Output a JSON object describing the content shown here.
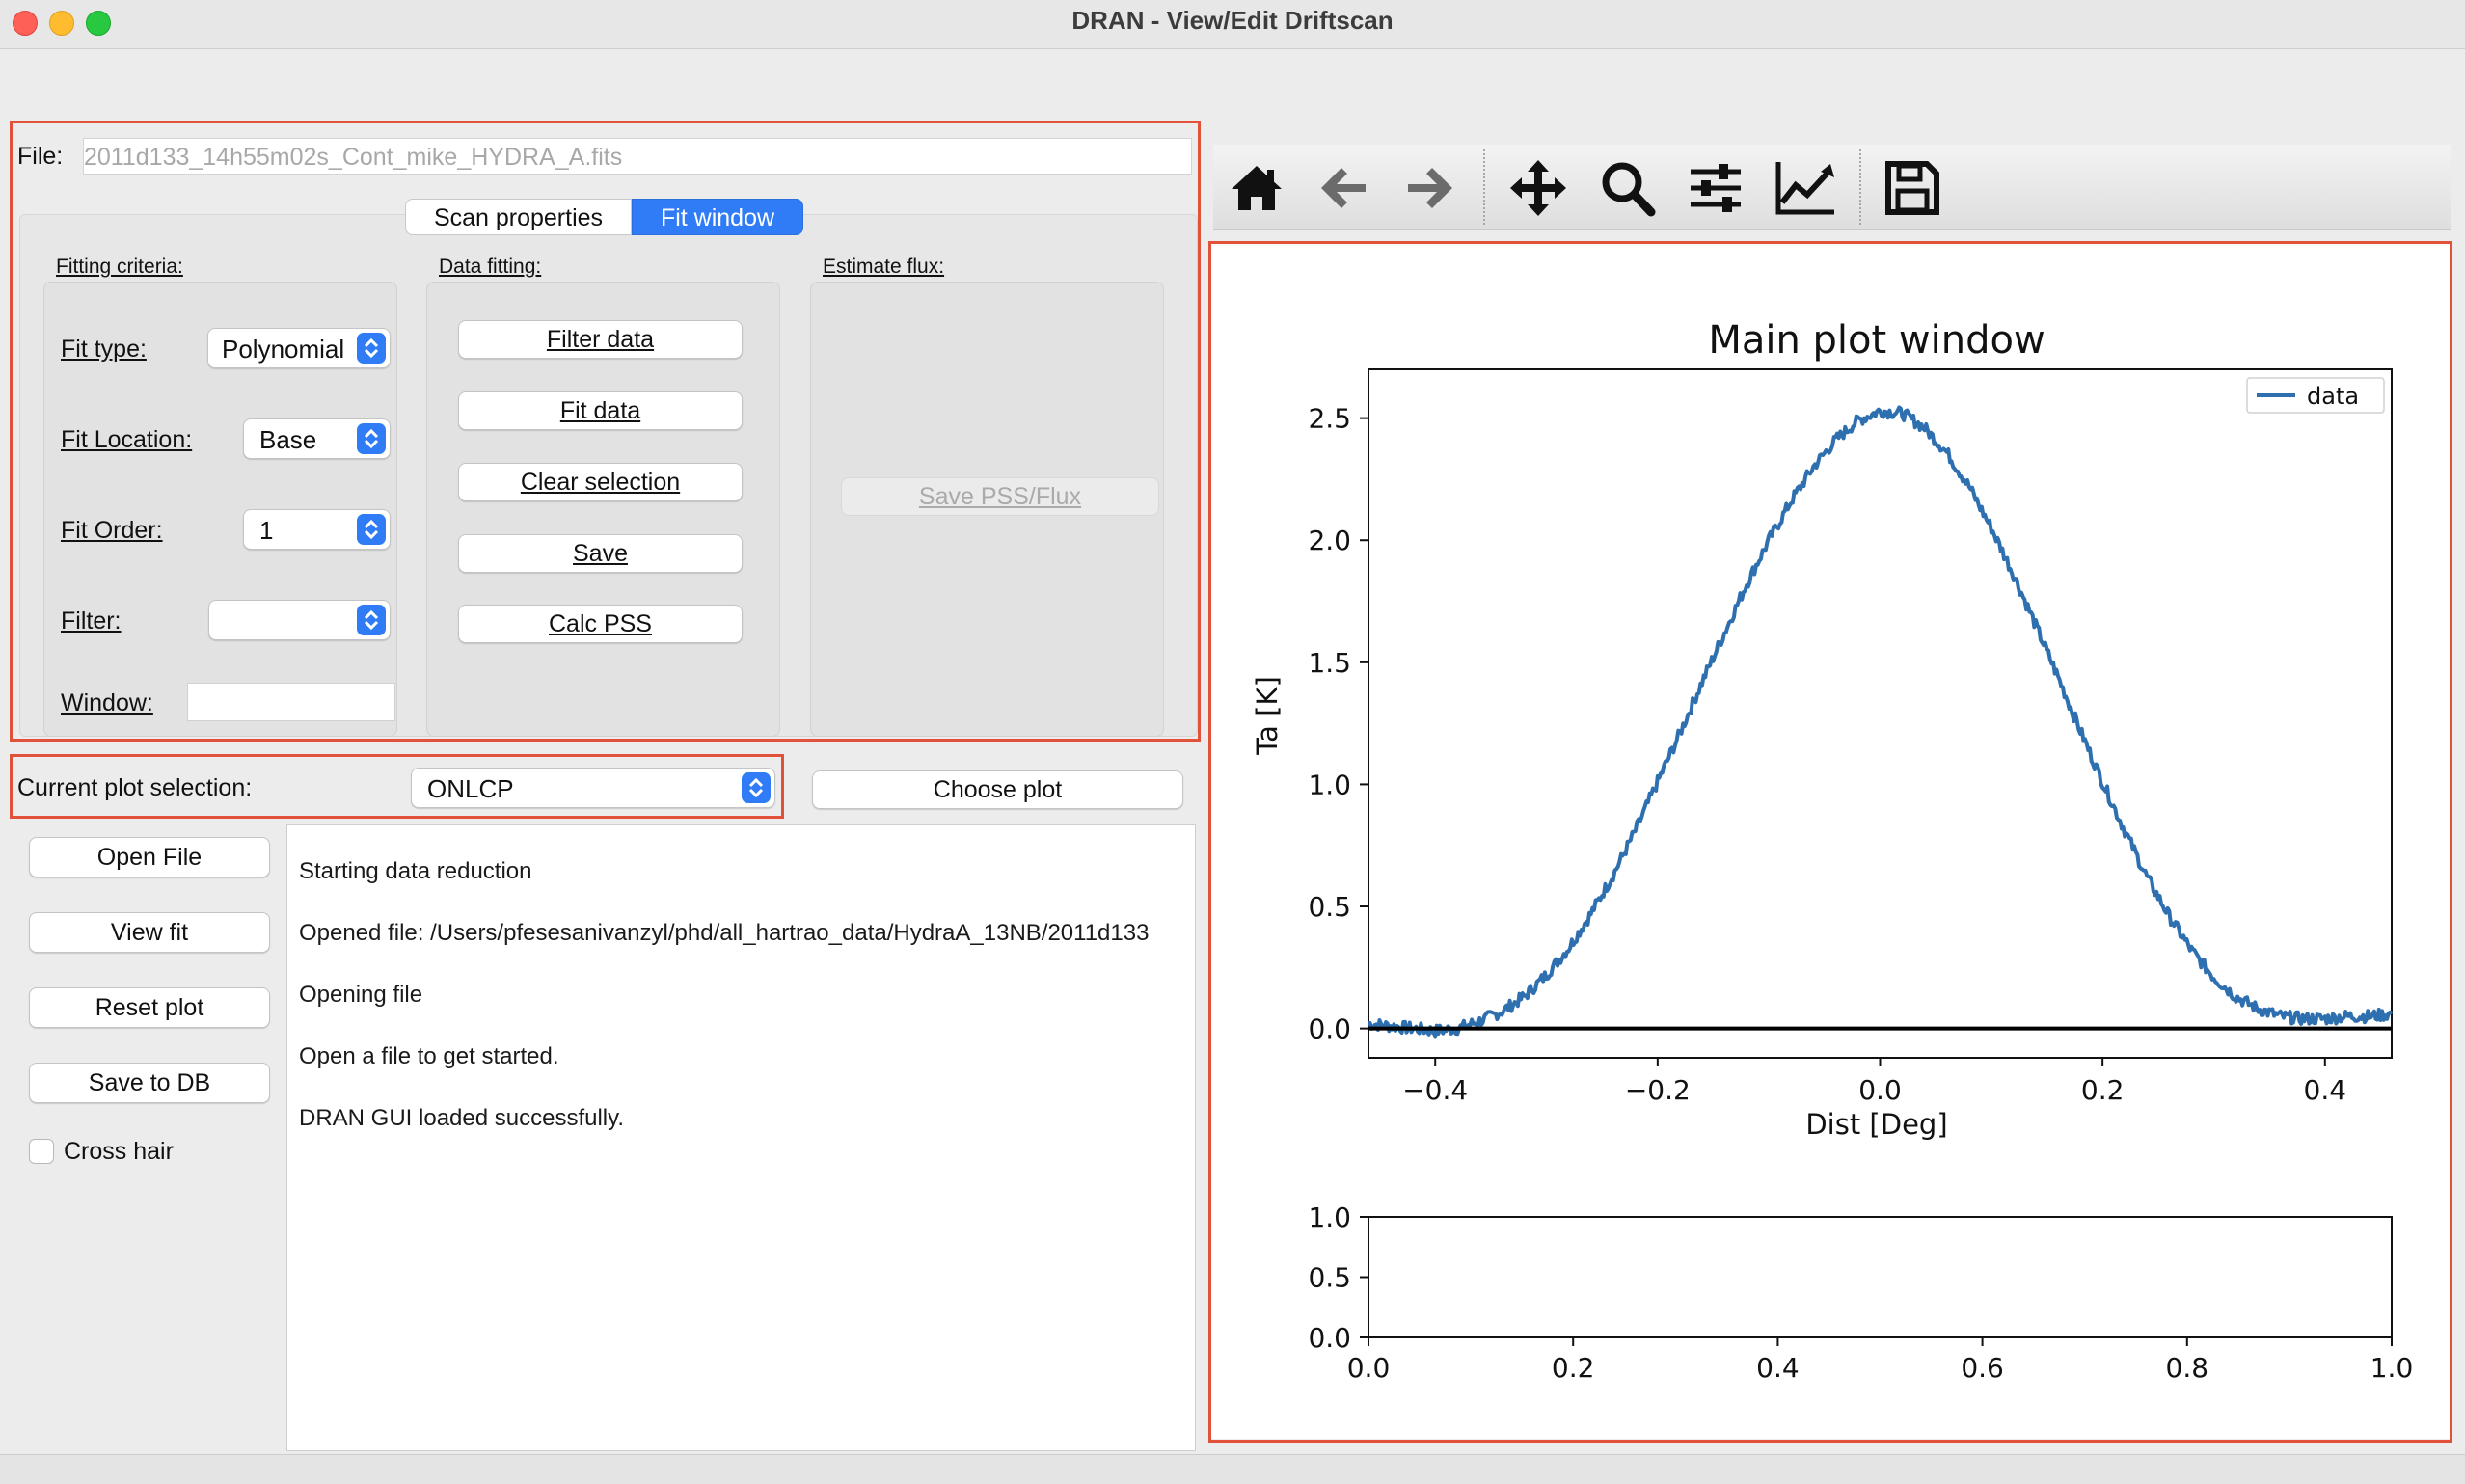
{
  "window": {
    "title": "DRAN - View/Edit Driftscan"
  },
  "file": {
    "label": "File:",
    "value": "2011d133_14h55m02s_Cont_mike_HYDRA_A.fits"
  },
  "tabs": [
    {
      "label": "Scan properties",
      "active": false
    },
    {
      "label": "Fit window",
      "active": true
    }
  ],
  "fitting_criteria": {
    "title": "Fitting criteria:",
    "fit_type_label": "Fit type:",
    "fit_type_value": "Polynomial",
    "fit_location_label": "Fit Location:",
    "fit_location_value": "Base",
    "fit_order_label": "Fit Order:",
    "fit_order_value": "1",
    "filter_label": "Filter:",
    "filter_value": "",
    "window_label": "Window:",
    "window_value": ""
  },
  "data_fitting": {
    "title": "Data fitting:",
    "buttons": [
      "Filter data",
      "Fit data",
      "Clear selection",
      "Save",
      "Calc PSS"
    ]
  },
  "estimate_flux": {
    "title": "Estimate flux:",
    "button": "Save PSS/Flux"
  },
  "plot_selection": {
    "label": "Current plot selection:",
    "value": "ONLCP",
    "choose_button": "Choose plot"
  },
  "side_buttons": [
    "Open File",
    "View fit",
    "Reset plot",
    "Save to DB"
  ],
  "cross_hair": {
    "label": "Cross hair",
    "checked": false
  },
  "log": [
    "Starting data reduction",
    "Opened file: /Users/pfesesanivanzyl/phd/all_hartrao_data/HydraA_13NB/2011d133",
    "Opening file",
    "Open a file to get started.",
    "DRAN GUI loaded successfully."
  ],
  "toolbar": {
    "icons": [
      "home-icon",
      "back-arrow-icon",
      "forward-arrow-icon",
      "pan-icon",
      "zoom-icon",
      "configure-subplots-icon",
      "edit-axis-icon",
      "save-figure-icon"
    ]
  },
  "colors": {
    "accent": "#2f7cf6",
    "highlight_border": "#e2513a",
    "series": "#2e6fb0"
  },
  "chart_data": [
    {
      "type": "line",
      "title": "Main plot window",
      "xlabel": "Dist [Deg]",
      "ylabel": "Ta [K]",
      "xlim": [
        -0.46,
        0.46
      ],
      "ylim": [
        -0.12,
        2.7
      ],
      "xticks": [
        -0.4,
        -0.2,
        0.0,
        0.2,
        0.4
      ],
      "xtick_labels": [
        "−0.4",
        "−0.2",
        "0.0",
        "0.2",
        "0.4"
      ],
      "yticks": [
        0.0,
        0.5,
        1.0,
        1.5,
        2.0,
        2.5
      ],
      "ytick_labels": [
        "0.0",
        "0.5",
        "1.0",
        "1.5",
        "2.0",
        "2.5"
      ],
      "legend": "top-right",
      "series": [
        {
          "name": "data",
          "color": "#2e6fb0",
          "x": [
            -0.46,
            -0.44,
            -0.42,
            -0.4,
            -0.38,
            -0.36,
            -0.34,
            -0.32,
            -0.3,
            -0.28,
            -0.26,
            -0.24,
            -0.22,
            -0.2,
            -0.18,
            -0.16,
            -0.14,
            -0.12,
            -0.1,
            -0.08,
            -0.06,
            -0.04,
            -0.02,
            0.0,
            0.02,
            0.04,
            0.06,
            0.08,
            0.1,
            0.12,
            0.14,
            0.16,
            0.18,
            0.2,
            0.22,
            0.24,
            0.26,
            0.28,
            0.3,
            0.32,
            0.34,
            0.36,
            0.38,
            0.4,
            0.42,
            0.44,
            0.46
          ],
          "y": [
            0.02,
            0.01,
            0.0,
            -0.01,
            0.0,
            0.03,
            0.07,
            0.13,
            0.22,
            0.33,
            0.47,
            0.63,
            0.81,
            1.01,
            1.21,
            1.42,
            1.62,
            1.82,
            2.0,
            2.16,
            2.3,
            2.41,
            2.49,
            2.53,
            2.52,
            2.46,
            2.36,
            2.22,
            2.05,
            1.86,
            1.65,
            1.44,
            1.22,
            1.01,
            0.81,
            0.62,
            0.46,
            0.32,
            0.21,
            0.13,
            0.08,
            0.05,
            0.04,
            0.04,
            0.05,
            0.05,
            0.06
          ]
        },
        {
          "name": "baseline",
          "color": "#000000",
          "x": [
            -0.46,
            0.46
          ],
          "y": [
            0.0,
            0.0
          ]
        }
      ]
    },
    {
      "type": "line",
      "title": "",
      "xlim": [
        0.0,
        1.0
      ],
      "ylim": [
        0.0,
        1.0
      ],
      "xticks": [
        0.0,
        0.2,
        0.4,
        0.6,
        0.8,
        1.0
      ],
      "xtick_labels": [
        "0.0",
        "0.2",
        "0.4",
        "0.6",
        "0.8",
        "1.0"
      ],
      "yticks": [
        0.0,
        0.5,
        1.0
      ],
      "ytick_labels": [
        "0.0",
        "0.5",
        "1.0"
      ],
      "series": []
    }
  ]
}
